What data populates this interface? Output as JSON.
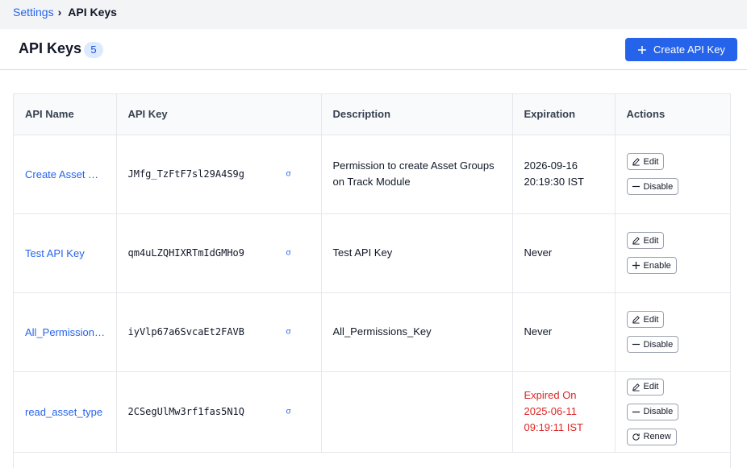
{
  "breadcrumb": {
    "parent": "Settings",
    "separator": "›",
    "current": "API Keys"
  },
  "header": {
    "title": "API Keys",
    "count": "5",
    "create_label": "Create API Key"
  },
  "table": {
    "columns": [
      "API Name",
      "API Key",
      "Description",
      "Expiration",
      "Actions"
    ],
    "rows": [
      {
        "name": "Create Asset Groups",
        "key": "JMfg_TzFtF7sl29A4S9g",
        "description": "Permission to create Asset Groups on Track Module",
        "expiration_line1": "2026-09-16",
        "expiration_line2": "20:19:30 IST",
        "expiration_line3": "",
        "actions": [
          "Edit",
          "Disable"
        ]
      },
      {
        "name": "Test API Key",
        "key": "qm4uLZQHIXRTmIdGMHo9",
        "description": "Test API Key",
        "expiration_line1": "Never",
        "expiration_line2": "",
        "expiration_line3": "",
        "actions": [
          "Edit",
          "Enable"
        ]
      },
      {
        "name": "All_Permissions_Key",
        "key": "iyVlp67a6SvcaEt2FAVB",
        "description": "All_Permissions_Key",
        "expiration_line1": "Never",
        "expiration_line2": "",
        "expiration_line3": "",
        "actions": [
          "Edit",
          "Disable"
        ]
      },
      {
        "name": "read_asset_type",
        "key": "2CSegUlMw3rf1fas5N1Q",
        "description": "",
        "expiration_line1": "Expired On",
        "expiration_line2": "2025-06-11",
        "expiration_line3": "09:19:11 IST",
        "actions": [
          "Edit",
          "Disable",
          "Renew"
        ]
      }
    ]
  },
  "colors": {
    "accent": "#2563eb",
    "expired": "#dc2626",
    "badge_bg": "#dbeafe"
  },
  "icons": {
    "create": "plus-icon",
    "edit": "pencil-icon",
    "disable": "minus-icon",
    "enable": "plus-icon",
    "renew": "refresh-icon",
    "reveal": "eye-icon"
  }
}
